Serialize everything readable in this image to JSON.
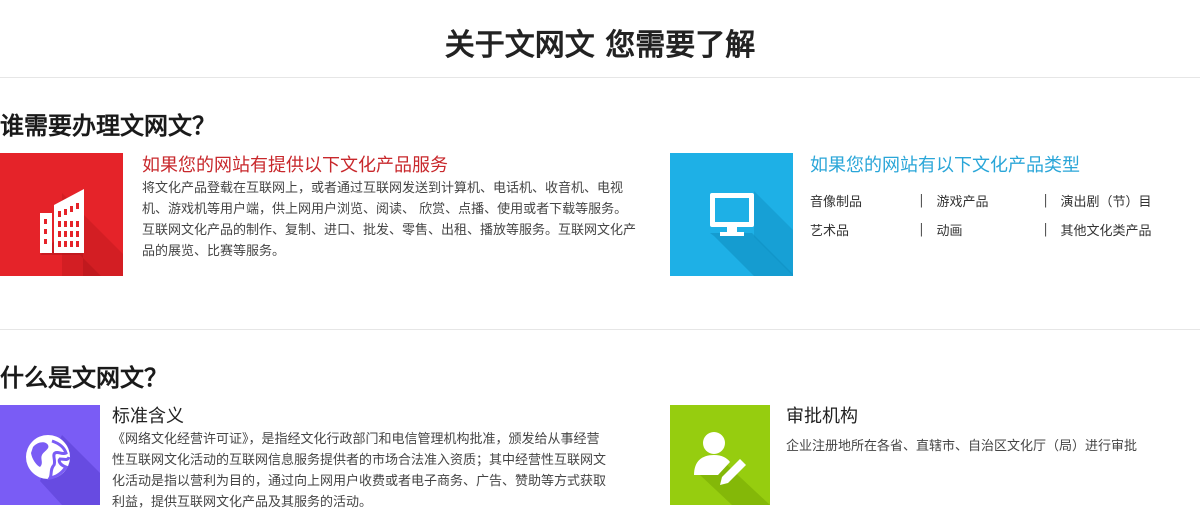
{
  "page_title": "关于文网文 您需要了解",
  "section1": {
    "title": "谁需要办理文网文？",
    "card_left": {
      "icon": "building-icon",
      "color": "#e52329",
      "heading": "如果您的网站有提供以下文化产品服务",
      "heading_color": "#c8282c",
      "paragraphs": [
        "将文化产品登载在互联网上，或者通过互联网发送到计算机、电话机、收音机、电视机、游戏机等用户端，供上网用户浏览、阅读、 欣赏、点播、使用或者下载等服务。",
        "互联网文化产品的制作、复制、进口、批发、零售、出租、播放等服务。互联网文化产品的展览、比赛等服务。"
      ]
    },
    "card_right": {
      "icon": "monitor-icon",
      "color": "#1eb0e6",
      "heading": "如果您的网站有以下文化产品类型",
      "heading_color": "#2aa6d8",
      "separator": "|",
      "categories": [
        [
          "音像制品",
          "游戏产品",
          "演出剧（节）目"
        ],
        [
          "艺术品",
          "动画",
          "其他文化类产品"
        ]
      ]
    }
  },
  "section2": {
    "title": "什么是文网文？",
    "card_left": {
      "icon": "globe-icon",
      "color": "#7a5cf5",
      "heading": "标准含义",
      "heading_color": "#222222",
      "text": "《网络文化经营许可证》，是指经文化行政部门和电信管理机构批准，颁发给从事经营性互联网文化活动的互联网信息服务提供者的市场合法准入资质；其中经营性互联网文化活动是指以营利为目的，通过向上网用户收费或者电子商务、广告、赞助等方式获取利益，提供互联网文化产品及其服务的活动。"
    },
    "card_right": {
      "icon": "user-edit-icon",
      "color": "#96cd0f",
      "heading": "审批机构",
      "heading_color": "#222222",
      "text": "企业注册地所在各省、直辖市、自治区文化厅（局）进行审批"
    }
  }
}
